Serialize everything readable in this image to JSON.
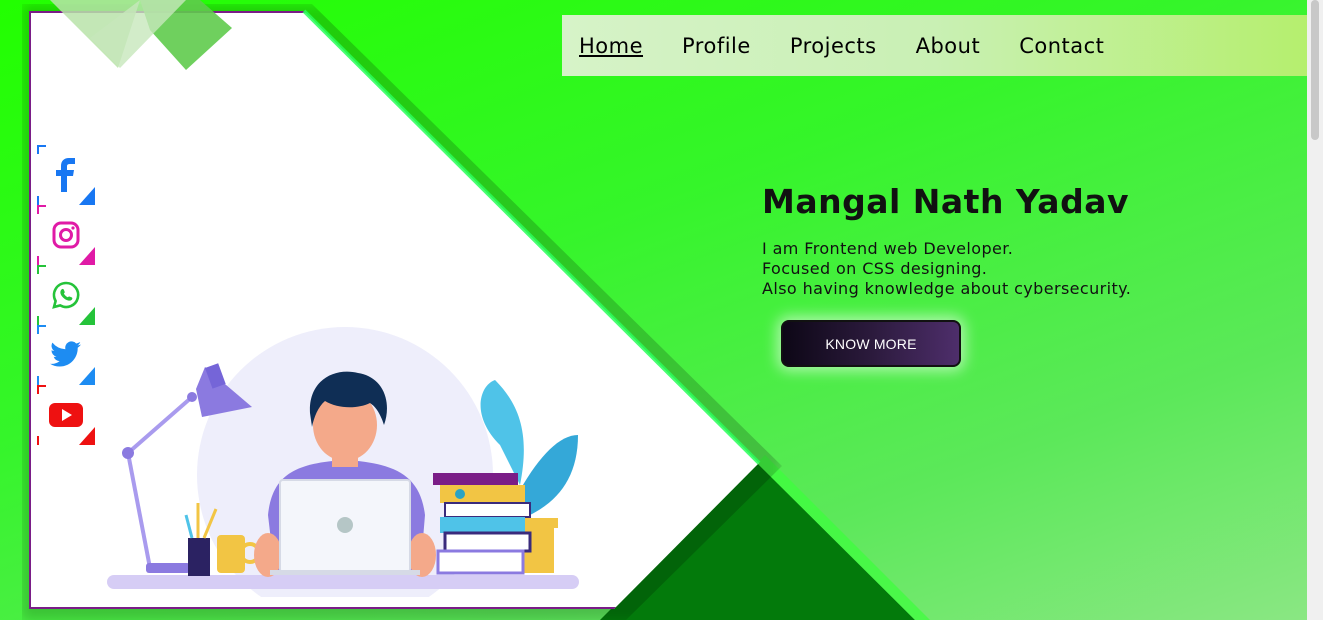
{
  "nav": {
    "items": [
      {
        "label": "Home",
        "active": true
      },
      {
        "label": "Profile"
      },
      {
        "label": "Projects"
      },
      {
        "label": "About"
      },
      {
        "label": "Contact"
      }
    ]
  },
  "social": [
    {
      "icon": "facebook-icon",
      "color": "#1877f2"
    },
    {
      "icon": "instagram-icon",
      "color": "#e1306c"
    },
    {
      "icon": "whatsapp-icon",
      "color": "#25d366"
    },
    {
      "icon": "twitter-icon",
      "color": "#1da1f2"
    },
    {
      "icon": "youtube-icon",
      "color": "#ff0000"
    }
  ],
  "hero": {
    "name": "Mangal Nath Yadav",
    "line1": "I am Frontend web Developer.",
    "line2": "Focused on CSS designing.",
    "line3": "Also having knowledge about cybersecurity.",
    "button": "KNOW MORE"
  },
  "colors": {
    "accent_green": "#22ff00",
    "dark_green": "#037a0b",
    "card_border": "#7a1d87",
    "button_dark": "#0d0716"
  }
}
